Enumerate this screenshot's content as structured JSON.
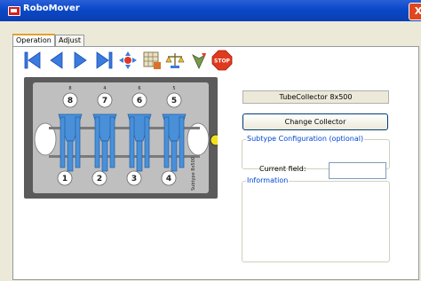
{
  "window": {
    "title": "RoboMover",
    "close_label": "X"
  },
  "tabs": [
    {
      "label": "Operation",
      "active": true
    },
    {
      "label": "Adjust",
      "active": false
    }
  ],
  "toolbar": {
    "buttons": [
      "skip-to-start-icon",
      "step-back-icon",
      "play-icon",
      "skip-to-end-icon",
      "move-arms-icon",
      "grid-config-icon",
      "scale-icon",
      "clean-icon",
      "stop-icon"
    ],
    "stop_label": "STOP"
  },
  "deck": {
    "top_positions": [
      "8",
      "7",
      "6",
      "5"
    ],
    "bottom_positions": [
      "1",
      "2",
      "3",
      "4"
    ],
    "small_top_labels": [
      "8",
      "4",
      "6",
      "5"
    ],
    "side_label": "Subtype 8x500",
    "colors": {
      "frame": "#5a5a5a",
      "tube": "#4a90d9",
      "indicator": "#f2e11a"
    }
  },
  "collector": {
    "selected": "TubeCollector 8x500",
    "change_button": "Change Collector"
  },
  "subtype_group": {
    "legend": "Subtype Configuration (optional)"
  },
  "information_group": {
    "legend": "Information",
    "current_field_label": "Current field:",
    "current_field_value": ""
  }
}
